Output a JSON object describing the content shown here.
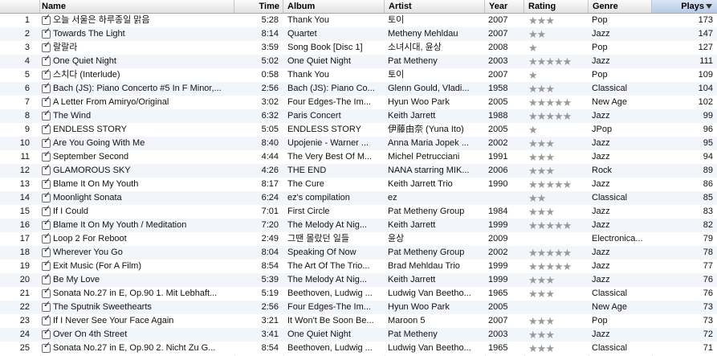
{
  "columns": {
    "num": "",
    "name": "Name",
    "time": "Time",
    "album": "Album",
    "artist": "Artist",
    "year": "Year",
    "rating": "Rating",
    "genre": "Genre",
    "plays": "Plays"
  },
  "sort": {
    "column": "plays",
    "direction": "descending"
  },
  "colors": {
    "sorted_header": "#b6c9e6",
    "stripe": "#f2f5fa",
    "star": "#9a9a9a"
  },
  "tracks": [
    {
      "num": "1",
      "checked": true,
      "name": "오늘 서울은 하루종일 맑음",
      "time": "5:28",
      "album": "Thank You",
      "artist": "토이",
      "year": "2007",
      "rating": 3,
      "genre": "Pop",
      "plays": "173"
    },
    {
      "num": "2",
      "checked": true,
      "name": "Towards The Light",
      "time": "8:14",
      "album": "Quartet",
      "artist": "Metheny Mehldau",
      "year": "2007",
      "rating": 2,
      "genre": "Jazz",
      "plays": "147"
    },
    {
      "num": "3",
      "checked": true,
      "name": "랄랄라",
      "time": "3:59",
      "album": "Song Book [Disc 1]",
      "artist": "소녀시대, 윤상",
      "year": "2008",
      "rating": 1,
      "genre": "Pop",
      "plays": "127"
    },
    {
      "num": "4",
      "checked": true,
      "name": "One Quiet Night",
      "time": "5:02",
      "album": "One Quiet Night",
      "artist": "Pat Metheny",
      "year": "2003",
      "rating": 5,
      "genre": "Jazz",
      "plays": "111"
    },
    {
      "num": "5",
      "checked": true,
      "name": "스치다 (Interlude)",
      "time": "0:58",
      "album": "Thank You",
      "artist": "토이",
      "year": "2007",
      "rating": 1,
      "genre": "Pop",
      "plays": "109"
    },
    {
      "num": "6",
      "checked": true,
      "name": "Bach (JS): Piano Concerto #5 In F Minor,...",
      "time": "2:56",
      "album": "Bach (JS): Piano Co...",
      "artist": "Glenn Gould, Vladi...",
      "year": "1958",
      "rating": 3,
      "genre": "Classical",
      "plays": "104"
    },
    {
      "num": "7",
      "checked": true,
      "name": "A Letter From Amiryo/Original",
      "time": "3:02",
      "album": "Four Edges-The Im...",
      "artist": "Hyun Woo Park",
      "year": "2005",
      "rating": 5,
      "genre": "New Age",
      "plays": "102"
    },
    {
      "num": "8",
      "checked": true,
      "name": "The Wind",
      "time": "6:32",
      "album": "Paris Concert",
      "artist": "Keith Jarrett",
      "year": "1988",
      "rating": 5,
      "genre": "Jazz",
      "plays": "99"
    },
    {
      "num": "9",
      "checked": true,
      "name": "ENDLESS STORY",
      "time": "5:05",
      "album": "ENDLESS STORY",
      "artist": "伊藤由奈 (Yuna Ito)",
      "year": "2005",
      "rating": 1,
      "genre": "JPop",
      "plays": "96"
    },
    {
      "num": "10",
      "checked": true,
      "name": "Are You Going With Me",
      "time": "8:40",
      "album": "Upojenie - Warner ...",
      "artist": "Anna Maria Jopek ...",
      "year": "2002",
      "rating": 3,
      "genre": "Jazz",
      "plays": "95"
    },
    {
      "num": "11",
      "checked": true,
      "name": "September Second",
      "time": "4:44",
      "album": "The Very Best Of M...",
      "artist": "Michel Petrucciani",
      "year": "1991",
      "rating": 3,
      "genre": "Jazz",
      "plays": "94"
    },
    {
      "num": "12",
      "checked": true,
      "name": "GLAMOROUS SKY",
      "time": "4:26",
      "album": "THE END",
      "artist": "NANA starring MIK...",
      "year": "2006",
      "rating": 3,
      "genre": "Rock",
      "plays": "89"
    },
    {
      "num": "13",
      "checked": true,
      "name": "Blame It On My Youth",
      "time": "8:17",
      "album": "The Cure",
      "artist": "Keith Jarrett Trio",
      "year": "1990",
      "rating": 5,
      "genre": "Jazz",
      "plays": "86"
    },
    {
      "num": "14",
      "checked": true,
      "name": "Moonlight Sonata",
      "time": "6:24",
      "album": "ez's compilation",
      "artist": "ez",
      "year": "",
      "rating": 2,
      "genre": "Classical",
      "plays": "85"
    },
    {
      "num": "15",
      "checked": true,
      "name": "If I Could",
      "time": "7:01",
      "album": "First Circle",
      "artist": "Pat Metheny Group",
      "year": "1984",
      "rating": 3,
      "genre": "Jazz",
      "plays": "83"
    },
    {
      "num": "16",
      "checked": true,
      "name": "Blame It On My Youth / Meditation",
      "time": "7:20",
      "album": "The Melody At Nig...",
      "artist": "Keith Jarrett",
      "year": "1999",
      "rating": 5,
      "genre": "Jazz",
      "plays": "82"
    },
    {
      "num": "17",
      "checked": true,
      "name": "Loop 2 For Reboot",
      "time": "2:49",
      "album": "그땐 몰랐던 일들",
      "artist": "윤상",
      "year": "2009",
      "rating": 0,
      "genre": "Electronica...",
      "plays": "79"
    },
    {
      "num": "18",
      "checked": true,
      "name": "Wherever You Go",
      "time": "8:04",
      "album": "Speaking Of Now",
      "artist": "Pat Metheny Group",
      "year": "2002",
      "rating": 5,
      "genre": "Jazz",
      "plays": "78"
    },
    {
      "num": "19",
      "checked": true,
      "name": "Exit Music (For A Film)",
      "time": "8:54",
      "album": "The Art Of The Trio...",
      "artist": "Brad Mehldau Trio",
      "year": "1999",
      "rating": 5,
      "genre": "Jazz",
      "plays": "77"
    },
    {
      "num": "20",
      "checked": true,
      "name": "Be My Love",
      "time": "5:39",
      "album": "The Melody At Nig...",
      "artist": "Keith Jarrett",
      "year": "1999",
      "rating": 3,
      "genre": "Jazz",
      "plays": "76"
    },
    {
      "num": "21",
      "checked": true,
      "name": "Sonata No.27 in E, Op.90 1. Mit Lebhaft...",
      "time": "5:19",
      "album": "Beethoven, Ludwig ...",
      "artist": "Ludwig Van Beetho...",
      "year": "1965",
      "rating": 3,
      "genre": "Classical",
      "plays": "76"
    },
    {
      "num": "22",
      "checked": true,
      "name": "The Sputnik Sweethearts",
      "time": "2:56",
      "album": "Four Edges-The Im...",
      "artist": "Hyun Woo Park",
      "year": "2005",
      "rating": 0,
      "genre": "New Age",
      "plays": "73"
    },
    {
      "num": "23",
      "checked": true,
      "name": "If I Never See Your Face Again",
      "time": "3:21",
      "album": "It Won't Be Soon Be...",
      "artist": "Maroon 5",
      "year": "2007",
      "rating": 3,
      "genre": "Pop",
      "plays": "73"
    },
    {
      "num": "24",
      "checked": true,
      "name": "Over On 4th Street",
      "time": "3:41",
      "album": "One Quiet Night",
      "artist": "Pat Metheny",
      "year": "2003",
      "rating": 3,
      "genre": "Jazz",
      "plays": "72"
    },
    {
      "num": "25",
      "checked": true,
      "name": "Sonata No.27 in E, Op.90 2. Nicht Zu G...",
      "time": "8:54",
      "album": "Beethoven, Ludwig ...",
      "artist": "Ludwig Van Beetho...",
      "year": "1965",
      "rating": 3,
      "genre": "Classical",
      "plays": "71"
    }
  ]
}
